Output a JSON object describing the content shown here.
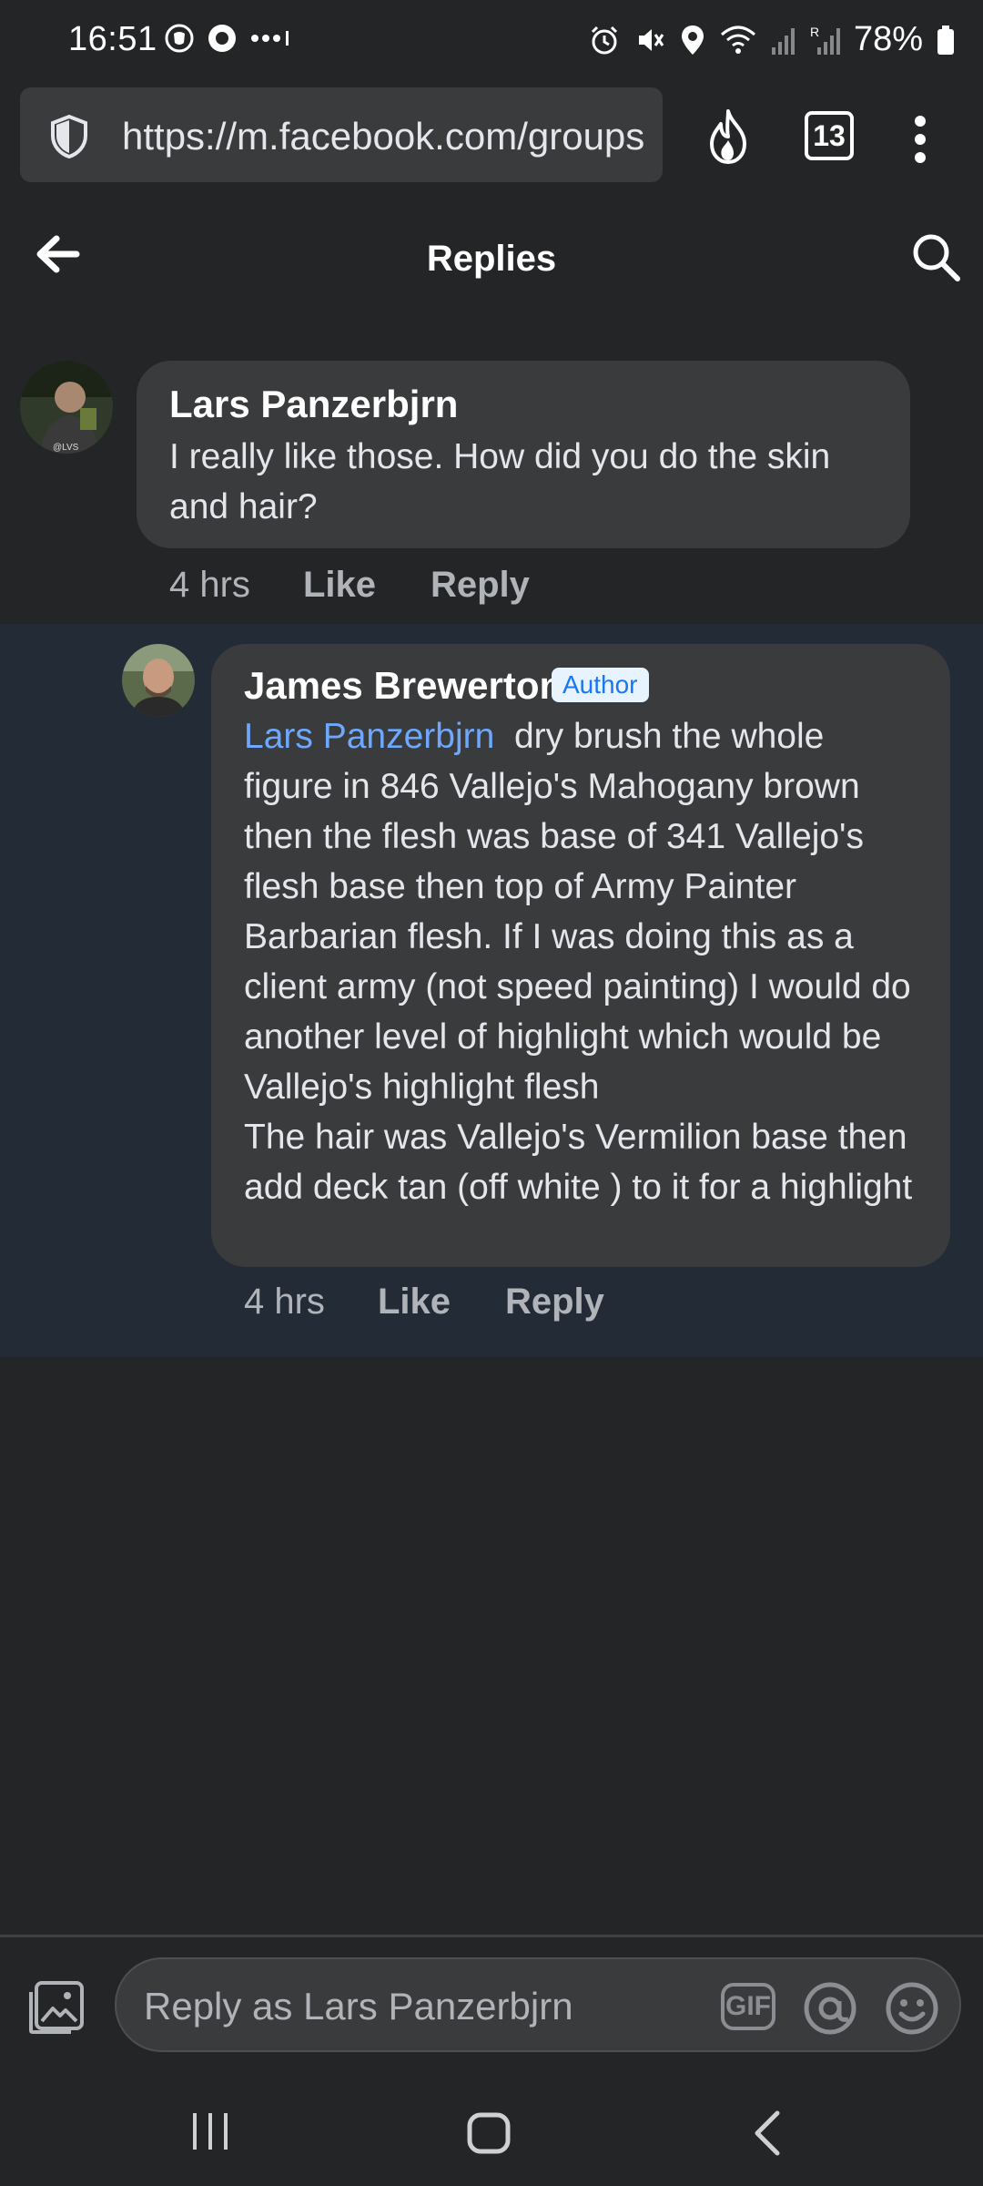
{
  "status_bar": {
    "time": "16:51",
    "battery": "78%"
  },
  "browser": {
    "url": "https://m.facebook.com/groups",
    "tab_count": "13"
  },
  "header": {
    "title": "Replies"
  },
  "comment": {
    "author": "Lars Panzerbjrn",
    "text": "I really like those. How did you do the skin and hair?",
    "time": "4 hrs",
    "like_label": "Like",
    "reply_label": "Reply"
  },
  "reply": {
    "author": "James Brewerton",
    "badge": "Author",
    "mention": "Lars Panzerbjrn",
    "text": "dry brush the whole figure in 846 Vallejo's Mahogany brown then the flesh was base of 341 Vallejo's flesh base then top of Army Painter Barbarian flesh. If I was doing this as a client army (not speed painting) I would do another level of highlight which would be Vallejo's highlight flesh",
    "text2": "The hair was Vallejo's Vermilion base then add deck tan (off white ) to it for a highlight",
    "time": "4 hrs",
    "like_label": "Like",
    "reply_label": "Reply"
  },
  "composer": {
    "placeholder": "Reply as Lars Panzerbjrn",
    "gif_label": "GIF"
  }
}
